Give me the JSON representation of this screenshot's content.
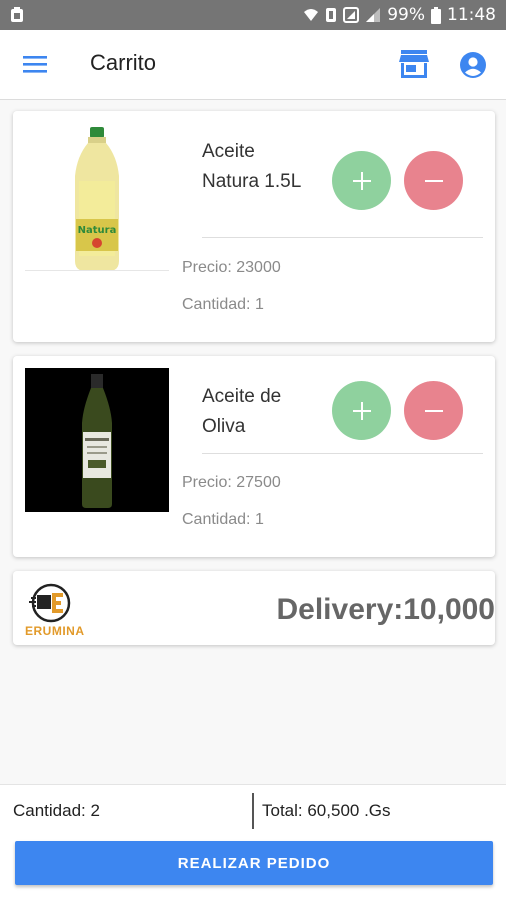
{
  "status_bar": {
    "battery": "99%",
    "time": "11:48"
  },
  "app_bar": {
    "title": "Carrito",
    "menu_icon": "menu-icon",
    "store_icon": "store-icon",
    "account_icon": "account-circle-icon"
  },
  "cart": {
    "items": [
      {
        "name": "Aceite Natura 1.5L",
        "price": "Precio: 23000",
        "quantity": "Cantidad: 1",
        "image_label": "Natura"
      },
      {
        "name": "Aceite de Oliva",
        "price": "Precio: 27500",
        "quantity": "Cantidad: 1"
      }
    ],
    "delivery": {
      "logo_text": "ERUMINA",
      "label": "Delivery:10,000"
    }
  },
  "footer": {
    "quantity": "Cantidad: 2",
    "total": "Total: 60,500 .Gs",
    "order_button": "REALIZAR PEDIDO"
  },
  "colors": {
    "primary": "#3d86f0",
    "plus": "#8fd19e",
    "minus": "#e8838e",
    "logo": "#e29a2a"
  }
}
